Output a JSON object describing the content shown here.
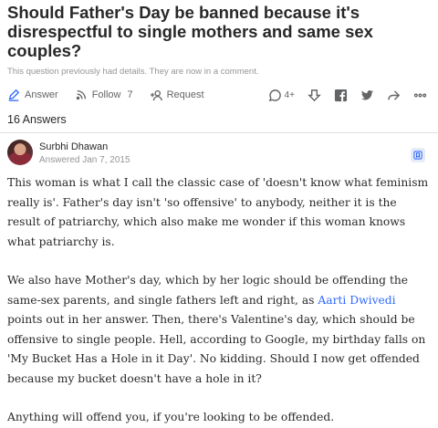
{
  "question": {
    "title": "Should Father's Day be banned because it's disrespectful to single mothers and same sex couples?",
    "note": "This question previously had details. They are now in a comment."
  },
  "actions": {
    "answer_label": "Answer",
    "follow_label": "Follow",
    "follow_count": "7",
    "request_label": "Request",
    "comments_count": "4+"
  },
  "answers_count": "16 Answers",
  "answer": {
    "author_name": "Surbhi Dhawan",
    "answered": "Answered Jan 7, 2015",
    "p1": "This woman is what I call the classic case of 'doesn't know what feminism really is'. Father's day isn't  'so offensive' to anybody, neither it is the result of patriarchy, which also make me wonder if this woman knows what patriarchy is.",
    "p2_before": "We also have Mother's day, which by her logic should be offending the same-sex parents, and single fathers left and right, as ",
    "p2_link": "Aarti Dwivedi",
    "p2_after": " points out in her answer. Then, there's Valentine's day, which should be offensive to single people. Hell, according to Google, my birthday falls on 'My Bucket Has a Hole in it Day'. No kidding. Should I now get offended because my bucket doesn't have a hole in it?",
    "p3": "Anything will offend you, if you're looking to be offended."
  },
  "colors": {
    "link": "#2e69ff",
    "muted": "#939598",
    "text": "#282829",
    "icon": "#636466"
  }
}
